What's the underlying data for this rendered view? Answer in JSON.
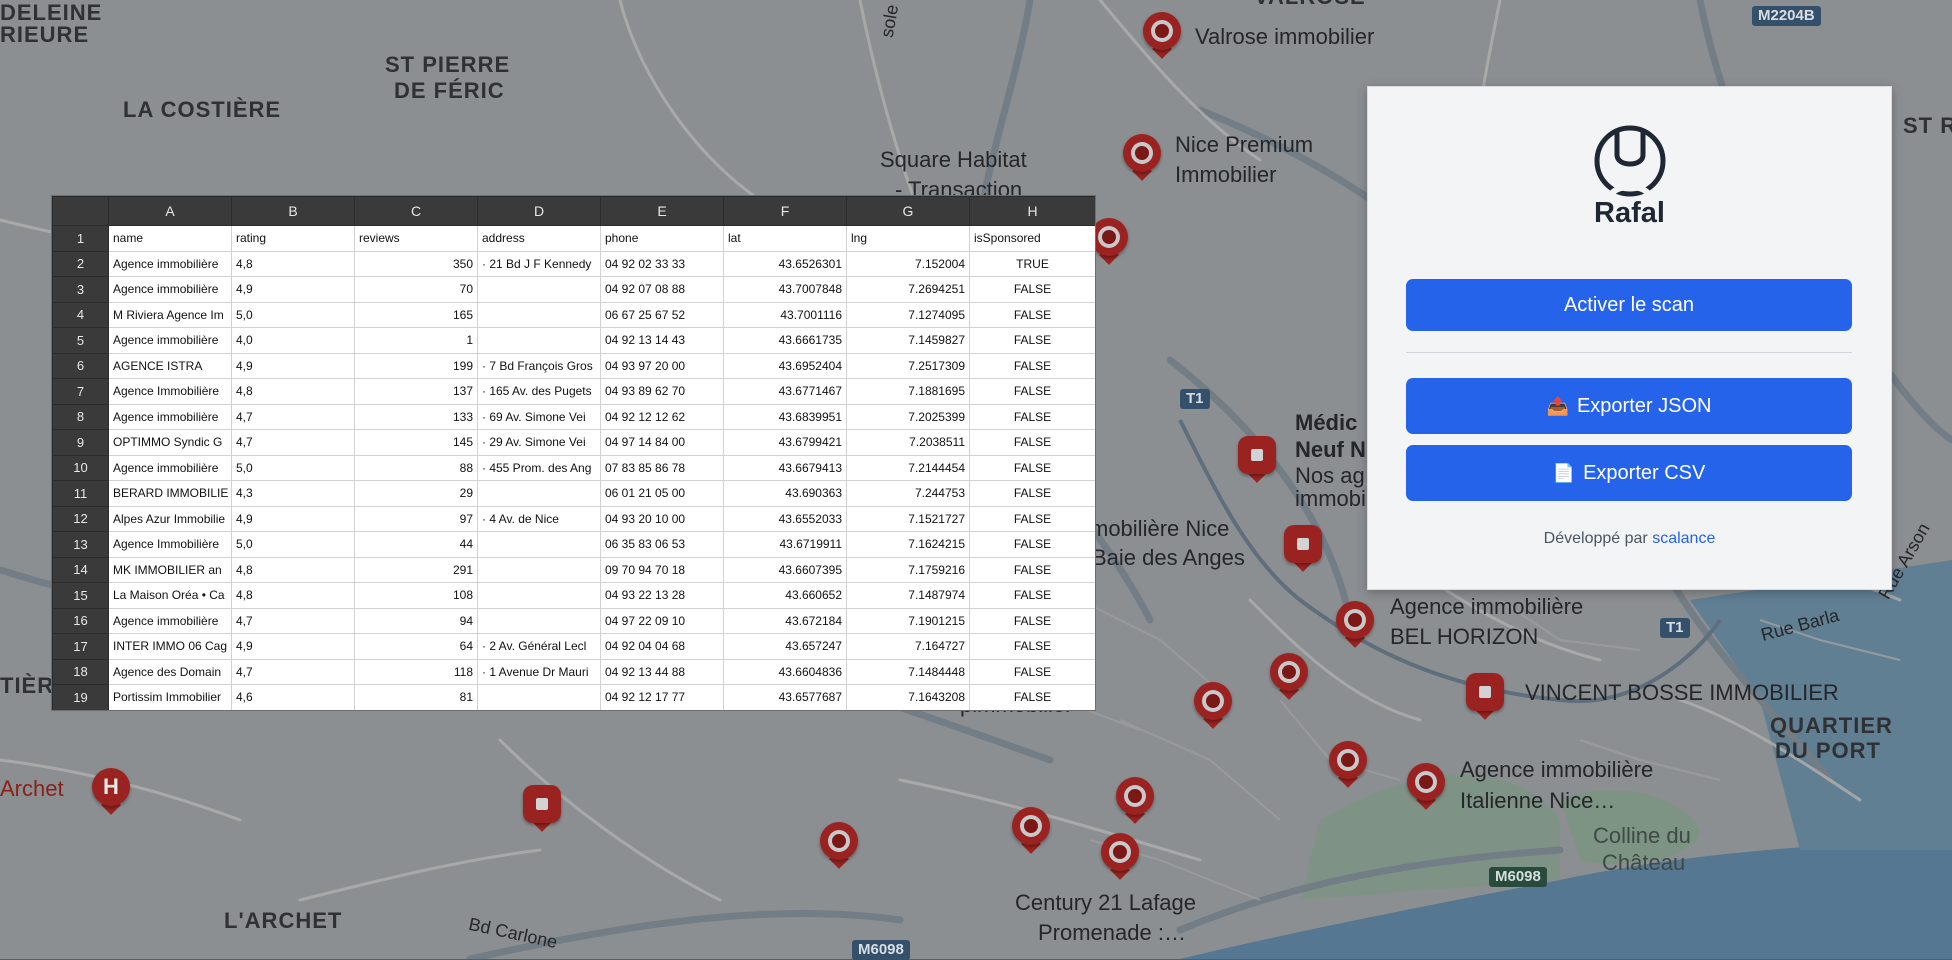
{
  "map": {
    "districts": [
      "DELEINE",
      "RIEURE",
      "LA COSTIÈRE",
      "ST PIERRE",
      "DE FÉRIC",
      "L'ARCHET",
      "QUARTIER",
      "DU PORT",
      "ST RO",
      "TIÈR",
      "VALROSE"
    ],
    "places": [
      "Valrose immobilier",
      "Nice Premium",
      "Immobilier",
      "Square Habitat",
      "- Transaction",
      "Médic",
      "Neuf N",
      "Nos ag",
      "immobi",
      "mobilière Nice",
      "Baie des Anges",
      "Agence immobilière",
      "BEL HORIZON",
      "VINCENT BOSSE IMMOBILIER",
      "Agence immobilière",
      "Italienne Nice…",
      "Colline du",
      "Château",
      "Century 21 Lafage",
      "Promenade :…",
      "Archet",
      "pimmobilier"
    ],
    "streets": [
      "Bd Carlone",
      "Rue Barla",
      "Rue Arson",
      "sole"
    ],
    "shields": [
      "M2204B",
      "T1",
      "T1",
      "M6098",
      "M6098"
    ],
    "hospital_letter": "H"
  },
  "sheet": {
    "columns": [
      "A",
      "B",
      "C",
      "D",
      "E",
      "F",
      "G",
      "H"
    ],
    "rows": [
      {
        "n": "1",
        "cells": [
          "name",
          "rating",
          "reviews",
          "address",
          "phone",
          "lat",
          "lng",
          "isSponsored"
        ]
      },
      {
        "n": "2",
        "cells": [
          "Agence immobilière",
          "4,8",
          "350",
          "· 21 Bd J F Kennedy",
          "04 92 02 33 33",
          "43.6526301",
          "7.152004",
          "TRUE"
        ]
      },
      {
        "n": "3",
        "cells": [
          "Agence immobilière",
          "4,9",
          "70",
          "",
          "04 92 07 08 88",
          "43.7007848",
          "7.2694251",
          "FALSE"
        ]
      },
      {
        "n": "4",
        "cells": [
          "M Riviera Agence Im",
          "5,0",
          "165",
          "",
          "06 67 25 67 52",
          "43.7001116",
          "7.1274095",
          "FALSE"
        ]
      },
      {
        "n": "5",
        "cells": [
          "Agence immobilière",
          "4,0",
          "1",
          "",
          "04 92 13 14 43",
          "43.6661735",
          "7.1459827",
          "FALSE"
        ]
      },
      {
        "n": "6",
        "cells": [
          "AGENCE ISTRA",
          "4,9",
          "199",
          "· 7 Bd François Gros",
          "04 93 97 20 00",
          "43.6952404",
          "7.2517309",
          "FALSE"
        ]
      },
      {
        "n": "7",
        "cells": [
          "Agence Immobilière",
          "4,8",
          "137",
          "· 165 Av. des Pugets",
          "04 93 89 62 70",
          "43.6771467",
          "7.1881695",
          "FALSE"
        ]
      },
      {
        "n": "8",
        "cells": [
          "Agence immobilière",
          "4,7",
          "133",
          "· 69 Av. Simone Vei",
          "04 92 12 12 62",
          "43.6839951",
          "7.2025399",
          "FALSE"
        ]
      },
      {
        "n": "9",
        "cells": [
          "OPTIMMO Syndic G",
          "4,7",
          "145",
          "· 29 Av. Simone Vei",
          "04 97 14 84 00",
          "43.6799421",
          "7.2038511",
          "FALSE"
        ]
      },
      {
        "n": "10",
        "cells": [
          "Agence immobilière",
          "5,0",
          "88",
          "· 455 Prom. des Ang",
          "07 83 85 86 78",
          "43.6679413",
          "7.2144454",
          "FALSE"
        ]
      },
      {
        "n": "11",
        "cells": [
          "BERARD IMMOBILIE",
          "4,3",
          "29",
          "",
          "06 01 21 05 00",
          "43.690363",
          "7.244753",
          "FALSE"
        ]
      },
      {
        "n": "12",
        "cells": [
          "Alpes Azur Immobilie",
          "4,9",
          "97",
          "· 4 Av. de Nice",
          "04 93 20 10 00",
          "43.6552033",
          "7.1521727",
          "FALSE"
        ]
      },
      {
        "n": "13",
        "cells": [
          "Agence Immobilière",
          "5,0",
          "44",
          "",
          "06 35 83 06 53",
          "43.6719911",
          "7.1624215",
          "FALSE"
        ]
      },
      {
        "n": "14",
        "cells": [
          "MK IMMOBILIER an",
          "4,8",
          "291",
          "",
          "09 70 94 70 18",
          "43.6607395",
          "7.1759216",
          "FALSE"
        ]
      },
      {
        "n": "15",
        "cells": [
          "La Maison Oréa • Ca",
          "4,8",
          "108",
          "",
          "04 93 22 13 28",
          "43.660652",
          "7.1487974",
          "FALSE"
        ]
      },
      {
        "n": "16",
        "cells": [
          "Agence immobilière",
          "4,7",
          "94",
          "",
          "04 97 22 09 10",
          "43.672184",
          "7.1901215",
          "FALSE"
        ]
      },
      {
        "n": "17",
        "cells": [
          "INTER IMMO 06 Cag",
          "4,9",
          "64",
          "· 2 Av. Général Lecl",
          "04 92 04 04 68",
          "43.657247",
          "7.164727",
          "FALSE"
        ]
      },
      {
        "n": "18",
        "cells": [
          "Agence des Domain",
          "4,7",
          "118",
          "· 1 Avenue Dr Mauri",
          "04 92 13 44 88",
          "43.6604836",
          "7.1484448",
          "FALSE"
        ]
      },
      {
        "n": "19",
        "cells": [
          "Portissim Immobilier",
          "4,6",
          "81",
          "",
          "04 92 12 17 77",
          "43.6577687",
          "7.1643208",
          "FALSE"
        ]
      }
    ]
  },
  "popup": {
    "brand": "Rafal",
    "scan_label": "Activer le scan",
    "export_json_icon": "📤",
    "export_json_label": "Exporter JSON",
    "export_csv_icon": "📄",
    "export_csv_label": "Exporter CSV",
    "footer_prefix": "Développé par",
    "footer_link": "scalance",
    "accent_color": "#2563eb"
  }
}
